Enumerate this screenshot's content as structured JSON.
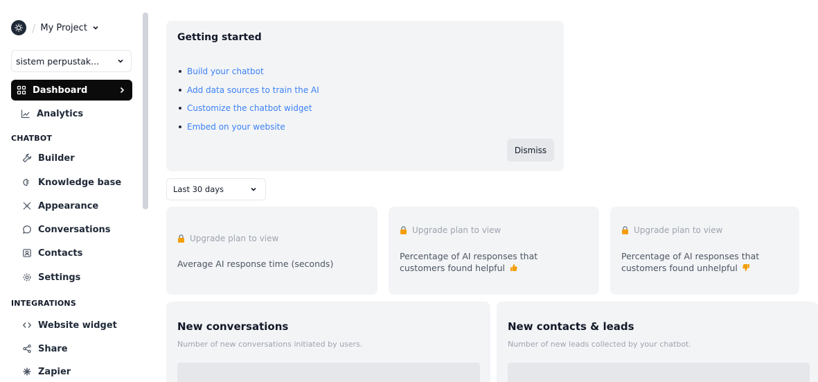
{
  "project": {
    "name": "My Project"
  },
  "workspace_select": {
    "value": "sistem perpustak..."
  },
  "nav": {
    "dashboard": "Dashboard",
    "analytics": "Analytics",
    "chatbot_heading": "CHATBOT",
    "builder": "Builder",
    "knowledge_base": "Knowledge base",
    "appearance": "Appearance",
    "conversations": "Conversations",
    "contacts": "Contacts",
    "settings": "Settings",
    "integrations_heading": "INTEGRATIONS",
    "website_widget": "Website widget",
    "share": "Share",
    "zapier": "Zapier"
  },
  "getting_started": {
    "title": "Getting started",
    "items": [
      "Build your chatbot",
      "Add data sources to train the AI",
      "Customize the chatbot widget",
      "Embed on your website"
    ],
    "dismiss_label": "Dismiss"
  },
  "date_range": {
    "value": "Last 30 days"
  },
  "stats": [
    {
      "lock_text": "Upgrade plan to view",
      "label": "Average AI response time (seconds)"
    },
    {
      "lock_text": "Upgrade plan to view",
      "label": "Percentage of AI responses that customers found helpful"
    },
    {
      "lock_text": "Upgrade plan to view",
      "label": "Percentage of AI responses that customers found unhelpful"
    }
  ],
  "panels": {
    "conversations": {
      "title": "New conversations",
      "subtitle": "Number of new conversations initiated by users."
    },
    "contacts": {
      "title": "New contacts & leads",
      "subtitle": "Number of new leads collected by your chatbot."
    }
  },
  "colors": {
    "accent_link": "#3b82f6",
    "active_nav_bg": "#0b0b0b",
    "card_bg": "#f3f4f6",
    "lock": "#f59e0b"
  }
}
